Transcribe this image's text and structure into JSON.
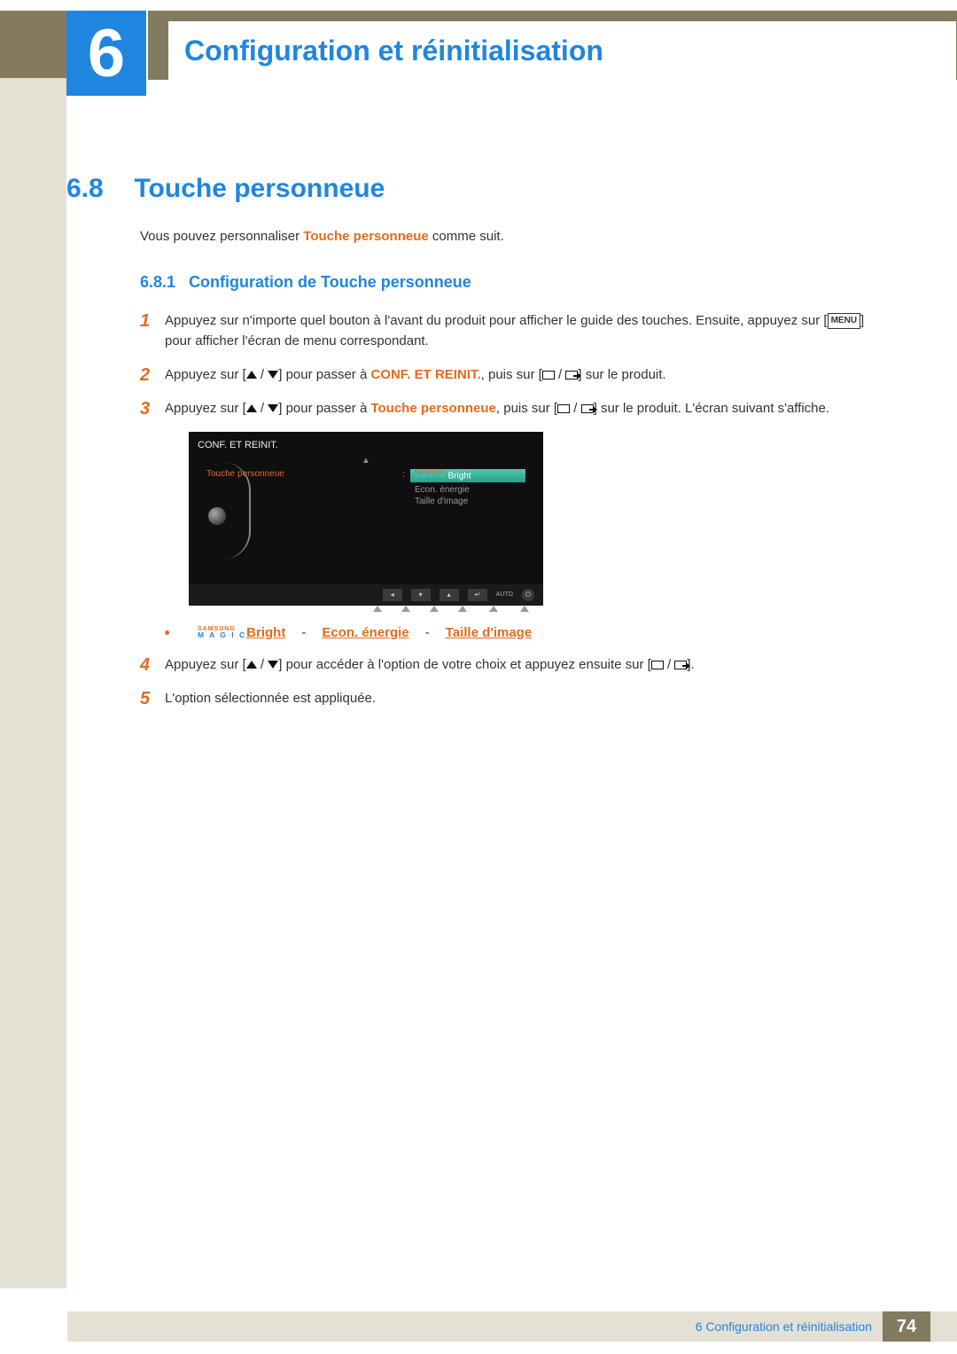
{
  "chapter": {
    "number": "6",
    "title": "Configuration et réinitialisation"
  },
  "section": {
    "number": "6.8",
    "title": "Touche personneue"
  },
  "intro": {
    "prefix": "Vous pouvez personnaliser ",
    "bold": "Touche personneue",
    "suffix": " comme suit."
  },
  "subsection": {
    "number": "6.8.1",
    "title": "Configuration de Touche personneue"
  },
  "steps": {
    "s1": {
      "num": "1",
      "p1a": "Appuyez sur n'importe quel bouton à l'avant du produit pour afficher le guide des touches. Ensuite, appuyez sur [",
      "menu": "MENU",
      "p1b": "] pour afficher l'écran de menu correspondant."
    },
    "s2": {
      "num": "2",
      "a": "Appuyez sur [",
      "b": "] pour passer à ",
      "bold": "CONF. ET REINIT.",
      "c": ", puis sur [",
      "d": "] sur le produit."
    },
    "s3": {
      "num": "3",
      "a": "Appuyez sur [",
      "b": "] pour passer à ",
      "bold": "Touche personneue",
      "c": ", puis sur [",
      "d": "] sur le produit. L'écran suivant s'affiche."
    },
    "s4": {
      "num": "4",
      "a": "Appuyez sur [",
      "b": "] pour accéder à l'option de votre choix et appuyez ensuite sur [",
      "c": "]."
    },
    "s5": {
      "num": "5",
      "text": "L'option sélectionnée est appliquée."
    }
  },
  "osd": {
    "title": "CONF. ET REINIT.",
    "left_label": "Touche personneue",
    "samsung": "SAMSUNG",
    "magic": "M A G I C",
    "bright": " Bright",
    "item2": "Econ. énergie",
    "item3": "Taille d'image",
    "auto": "AUTO",
    "colon": ":"
  },
  "bullets": {
    "bright": "Bright",
    "econ": "Econ. énergie",
    "taille": "Taille d'image",
    "dash": "-"
  },
  "footer": {
    "text": "6 Configuration et réinitialisation",
    "page": "74"
  }
}
